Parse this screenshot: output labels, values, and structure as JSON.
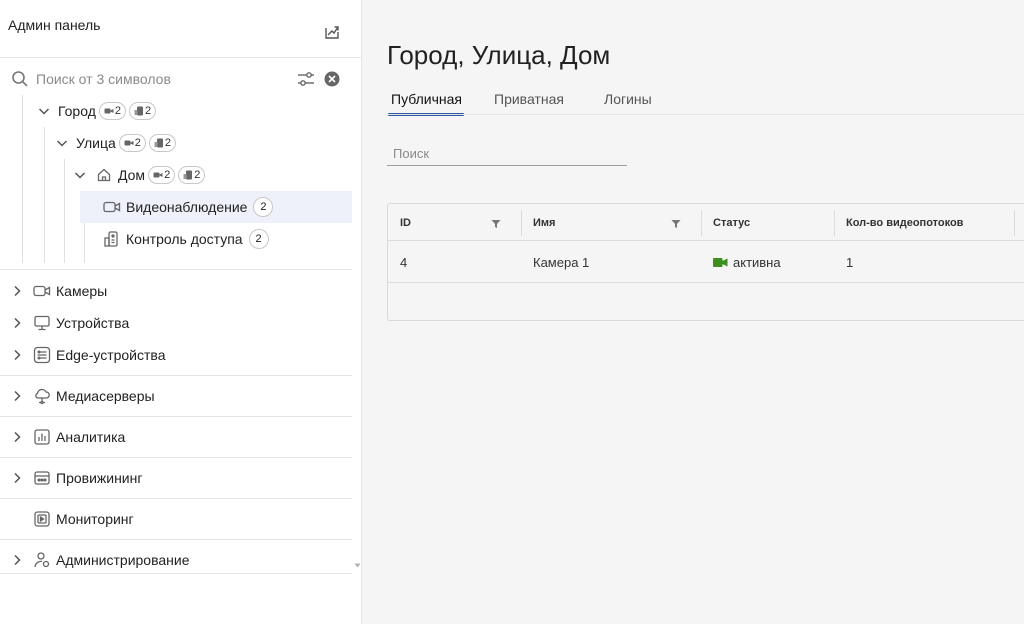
{
  "sidebar": {
    "title": "Админ панель",
    "search": {
      "placeholder": "Поиск от 3 символов",
      "value": ""
    },
    "tree": {
      "city": {
        "label": "Город",
        "cameras": "2",
        "access": "2"
      },
      "street": {
        "label": "Улица",
        "cameras": "2",
        "access": "2"
      },
      "house": {
        "label": "Дом",
        "cameras": "2",
        "access": "2"
      },
      "video": {
        "label": "Видеонаблюдение",
        "count": "2"
      },
      "access_control": {
        "label": "Контроль доступа",
        "count": "2"
      }
    },
    "nav": {
      "cameras": "Камеры",
      "devices": "Устройства",
      "edge": "Edge-устройства",
      "media": "Медиасерверы",
      "analytics": "Аналитика",
      "provisioning": "Провижининг",
      "monitoring": "Мониторинг",
      "admin": "Администрирование"
    }
  },
  "main": {
    "title": "Город, Улица, Дом",
    "tabs": [
      "Публичная",
      "Приватная",
      "Логины"
    ],
    "filter": {
      "placeholder": "Поиск",
      "value": ""
    },
    "table": {
      "columns": [
        "ID",
        "Имя",
        "Статус",
        "Кол-во видеопотоков"
      ],
      "rows": [
        {
          "id": "4",
          "name": "Камера 1",
          "status": "активна",
          "streams": "1"
        }
      ]
    }
  },
  "colors": {
    "accent": "#2f5aa8",
    "status_active": "#3c8f1e",
    "selected_bg": "#eef0fa"
  }
}
